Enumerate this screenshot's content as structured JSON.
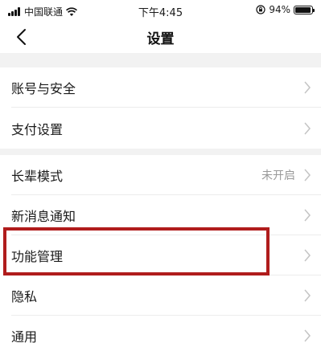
{
  "status_bar": {
    "carrier": "中国联通",
    "time": "下午4:45",
    "battery": "94%",
    "battery_level": 0.94
  },
  "header": {
    "title": "设置"
  },
  "settings": {
    "account_security": "账号与安全",
    "payment": "支付设置",
    "elder_mode": "长辈模式",
    "elder_mode_value": "未开启",
    "notifications": "新消息通知",
    "feature_management": "功能管理",
    "privacy": "隐私",
    "general": "通用"
  },
  "colors": {
    "highlight": "#b01c1c",
    "section_gap": "#f2f2f2"
  }
}
